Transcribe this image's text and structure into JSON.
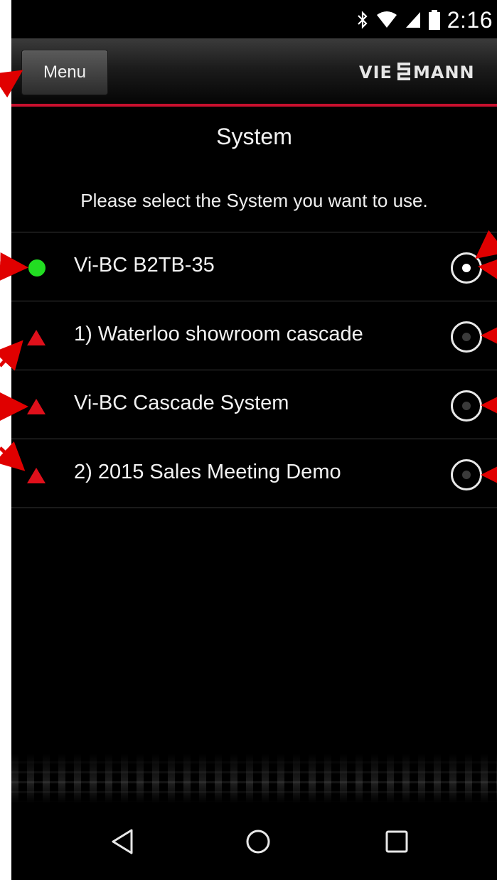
{
  "status_bar": {
    "time": "2:16",
    "icons": [
      "bluetooth-icon",
      "wifi-icon",
      "signal-icon",
      "battery-icon"
    ]
  },
  "header": {
    "menu_label": "Menu",
    "logo_text": "VIESMANN",
    "accent_color": "#c8102e"
  },
  "page": {
    "title": "System",
    "subtitle": "Please select the System you want to use."
  },
  "systems": [
    {
      "label": "Vi-BC B2TB-35",
      "status": "online",
      "selected": true
    },
    {
      "label": "1) Waterloo showroom cascade",
      "status": "warning",
      "selected": false
    },
    {
      "label": "Vi-BC Cascade System",
      "status": "warning",
      "selected": false
    },
    {
      "label": "2) 2015 Sales Meeting Demo",
      "status": "warning",
      "selected": false
    }
  ],
  "colors": {
    "online": "#22dd22",
    "warning": "#e0101b",
    "annotation": "#e00000"
  },
  "navbar": {
    "buttons": [
      "back-icon",
      "home-icon",
      "recents-icon"
    ]
  }
}
